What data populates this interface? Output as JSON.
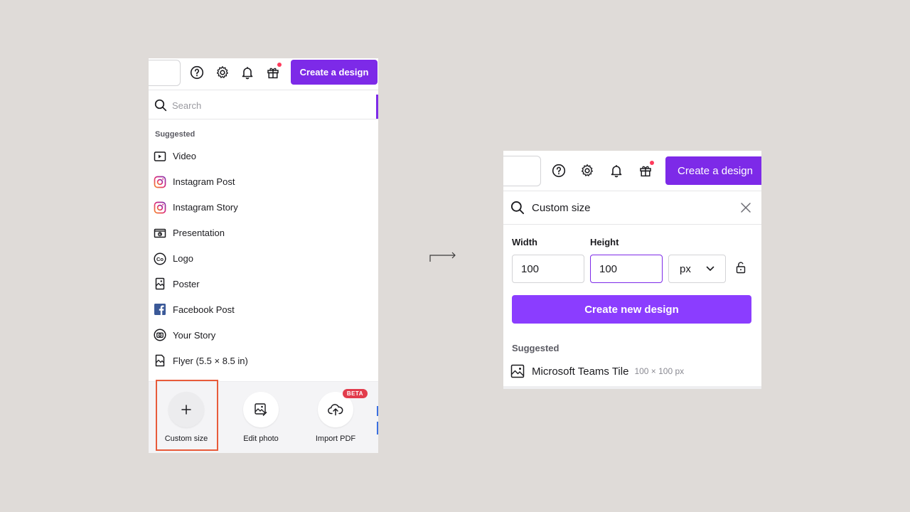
{
  "left_panel": {
    "header": {
      "create_label": "Create a design"
    },
    "search": {
      "placeholder": "Search"
    },
    "suggested_label": "Suggested",
    "suggested_items": [
      {
        "label": "Video",
        "icon": "video-icon"
      },
      {
        "label": "Instagram Post",
        "icon": "instagram-icon"
      },
      {
        "label": "Instagram Story",
        "icon": "instagram-icon"
      },
      {
        "label": "Presentation",
        "icon": "presentation-icon"
      },
      {
        "label": "Logo",
        "icon": "logo-co-icon"
      },
      {
        "label": "Poster",
        "icon": "poster-icon"
      },
      {
        "label": "Facebook Post",
        "icon": "facebook-icon"
      },
      {
        "label": "Your Story",
        "icon": "camera-icon"
      },
      {
        "label": "Flyer (5.5 × 8.5 in)",
        "icon": "flyer-icon"
      }
    ],
    "quick_actions": [
      {
        "label": "Custom size",
        "icon": "plus-icon"
      },
      {
        "label": "Edit photo",
        "icon": "edit-photo-icon"
      },
      {
        "label": "Import PDF",
        "icon": "cloud-upload-icon",
        "badge": "BETA"
      }
    ]
  },
  "right_panel": {
    "header": {
      "create_label": "Create a design"
    },
    "search": {
      "value": "Custom size"
    },
    "width_label": "Width",
    "height_label": "Height",
    "width_value": "100",
    "height_value": "100",
    "unit": "px",
    "create_new_label": "Create new design",
    "suggested_label": "Suggested",
    "suggestion": {
      "name": "Microsoft Teams Tile",
      "dims": "100 × 100 px"
    }
  },
  "colors": {
    "brand_purple": "#7d2ae8",
    "button_purple": "#8b3dff",
    "highlight_orange": "#e85b3a",
    "beta_red": "#e23c4c",
    "background": "#dfdbd8"
  }
}
